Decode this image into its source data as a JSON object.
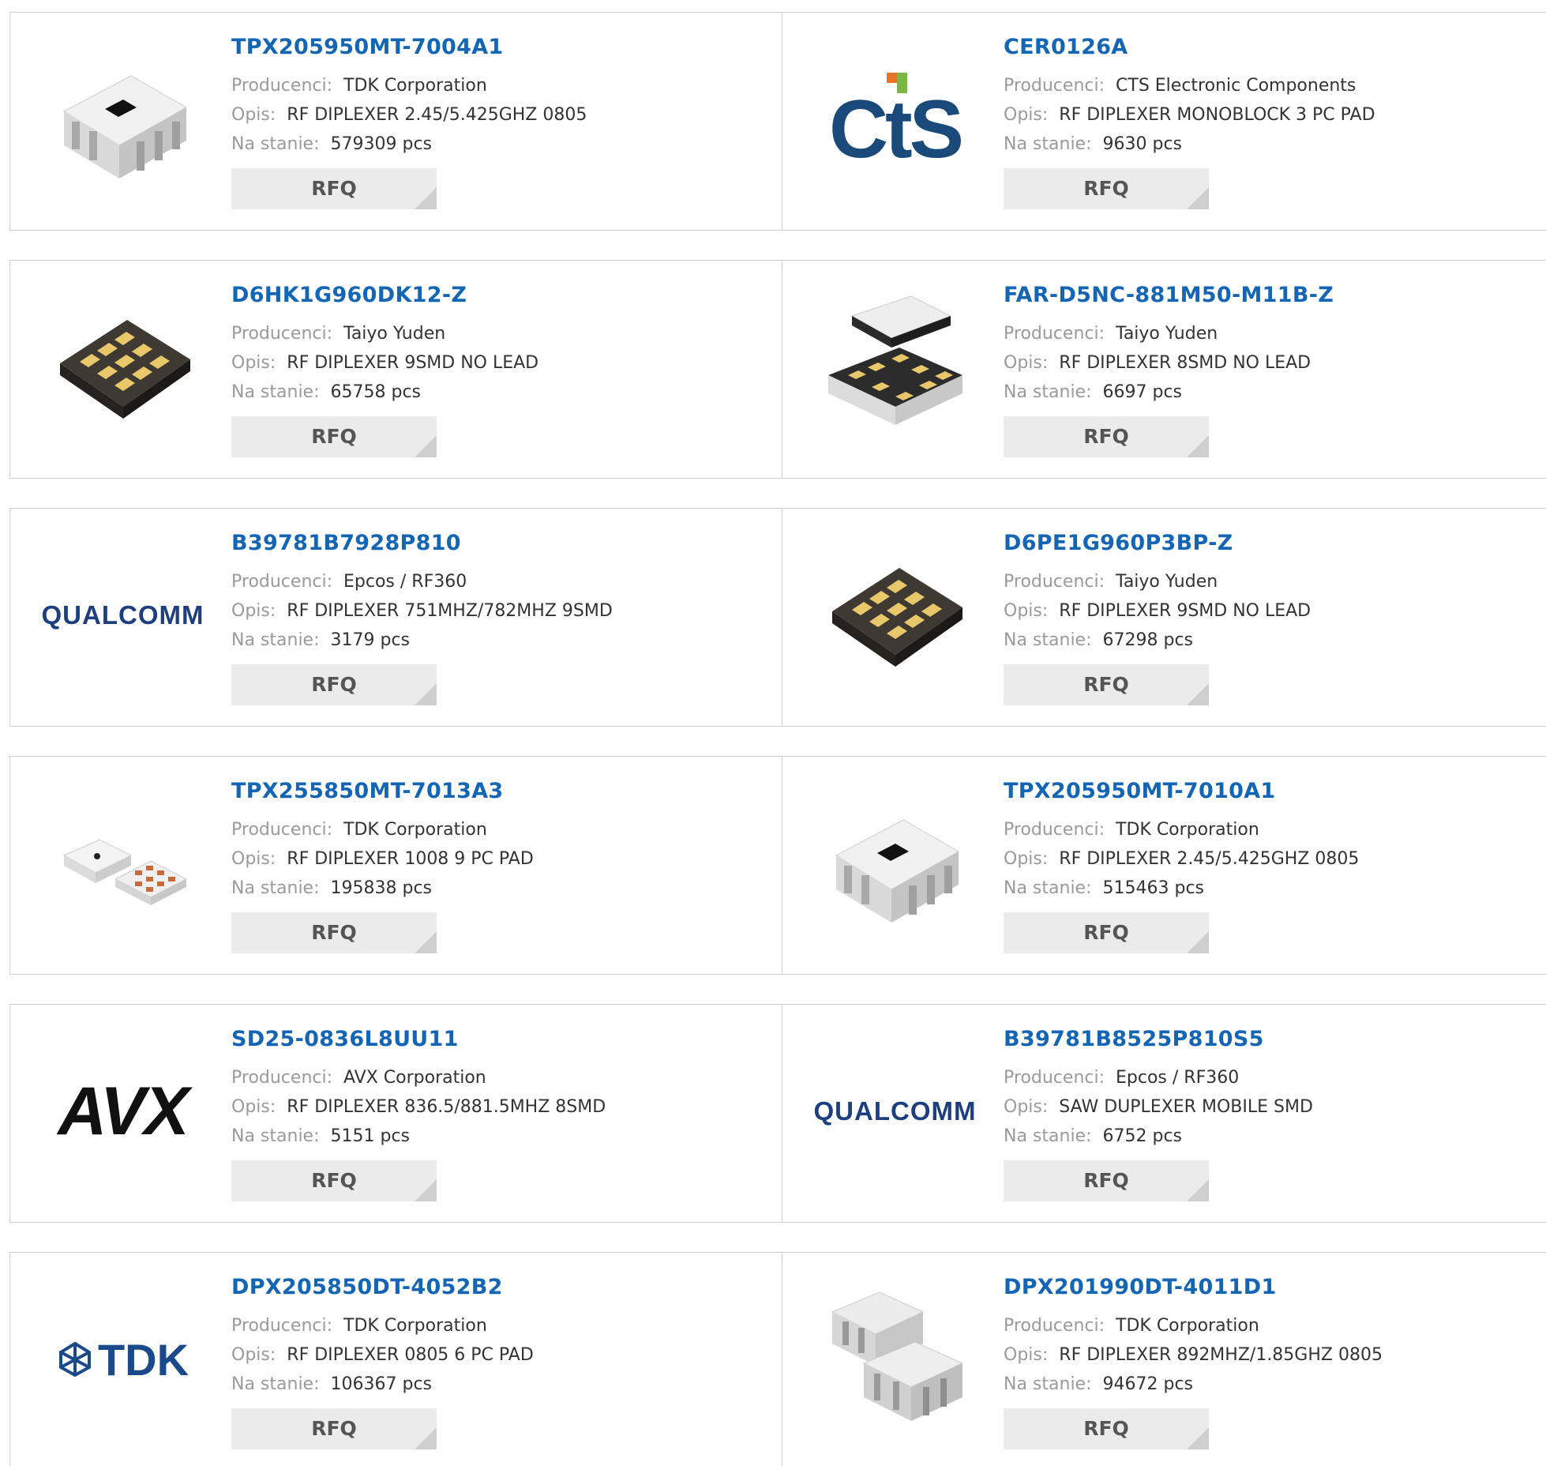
{
  "labels": {
    "manufacturer": "Producenci:",
    "description": "Opis:",
    "stock": "Na stanie:",
    "rfq": "RFQ"
  },
  "colors": {
    "link": "#1565b5",
    "label": "#9a9a9a",
    "button_bg": "#ebebeb"
  },
  "products": [
    {
      "pn": "TPX205950MT-7004A1",
      "manufacturer": "TDK Corporation",
      "description": "RF DIPLEXER 2.45/5.425GHZ 0805",
      "stock": "579309 pcs",
      "image": "chip-smd-photo"
    },
    {
      "pn": "CER0126A",
      "manufacturer": "CTS Electronic Components",
      "description": "RF DIPLEXER MONOBLOCK 3 PC PAD",
      "stock": "9630 pcs",
      "image": "cts-logo",
      "logo_text": "CtS"
    },
    {
      "pn": "D6HK1G960DK12-Z",
      "manufacturer": "Taiyo Yuden",
      "description": "RF DIPLEXER 9SMD NO LEAD",
      "stock": "65758 pcs",
      "image": "chip-pads-photo"
    },
    {
      "pn": "FAR-D5NC-881M50-M11B-Z",
      "manufacturer": "Taiyo Yuden",
      "description": "RF DIPLEXER 8SMD NO LEAD",
      "stock": "6697 pcs",
      "image": "chip-exploded-photo"
    },
    {
      "pn": "B39781B7928P810",
      "manufacturer": "Epcos / RF360",
      "description": "RF DIPLEXER 751MHZ/782MHZ 9SMD",
      "stock": "3179 pcs",
      "image": "qualcomm-logo",
      "logo_text": "QUALCOMM"
    },
    {
      "pn": "D6PE1G960P3BP-Z",
      "manufacturer": "Taiyo Yuden",
      "description": "RF DIPLEXER 9SMD NO LEAD",
      "stock": "67298 pcs",
      "image": "chip-pads-photo"
    },
    {
      "pn": "TPX255850MT-7013A3",
      "manufacturer": "TDK Corporation",
      "description": "RF DIPLEXER 1008 9 PC PAD",
      "stock": "195838 pcs",
      "image": "chip-pair-photo"
    },
    {
      "pn": "TPX205950MT-7010A1",
      "manufacturer": "TDK Corporation",
      "description": "RF DIPLEXER 2.45/5.425GHZ 0805",
      "stock": "515463 pcs",
      "image": "chip-smd-photo"
    },
    {
      "pn": "SD25-0836L8UU11",
      "manufacturer": "AVX Corporation",
      "description": "RF DIPLEXER 836.5/881.5MHZ 8SMD",
      "stock": "5151 pcs",
      "image": "avx-logo",
      "logo_text": "AVX"
    },
    {
      "pn": "B39781B8525P810S5",
      "manufacturer": "Epcos / RF360",
      "description": "SAW DUPLEXER MOBILE SMD",
      "stock": "6752 pcs",
      "image": "qualcomm-logo",
      "logo_text": "QUALCOMM"
    },
    {
      "pn": "DPX205850DT-4052B2",
      "manufacturer": "TDK Corporation",
      "description": "RF DIPLEXER 0805 6 PC PAD",
      "stock": "106367 pcs",
      "image": "tdk-logo",
      "logo_text": "TDK"
    },
    {
      "pn": "DPX201990DT-4011D1",
      "manufacturer": "TDK Corporation",
      "description": "RF DIPLEXER 892MHZ/1.85GHZ 0805",
      "stock": "94672 pcs",
      "image": "chip-double-photo"
    }
  ]
}
